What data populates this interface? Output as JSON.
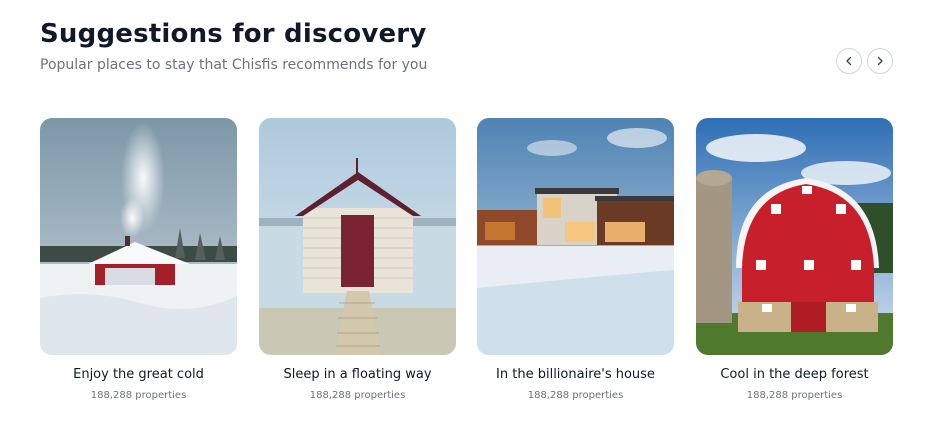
{
  "section": {
    "title": "Suggestions for discovery",
    "subtitle": "Popular places to stay that Chisfis recommends for you"
  },
  "nav": {
    "prev_icon": "chevron-left-icon",
    "next_icon": "chevron-right-icon"
  },
  "cards": [
    {
      "name": "Enjoy the great cold",
      "count": "188,288 properties",
      "image": "snowy red cabin with chimney smoke"
    },
    {
      "name": "Sleep in a floating way",
      "count": "188,288 properties",
      "image": "white boat house on water with wooden pier"
    },
    {
      "name": "In the billionaire's house",
      "count": "188,288 properties",
      "image": "modern luxury house in snow"
    },
    {
      "name": "Cool in the deep forest",
      "count": "188,288 properties",
      "image": "red barn with silo"
    }
  ]
}
